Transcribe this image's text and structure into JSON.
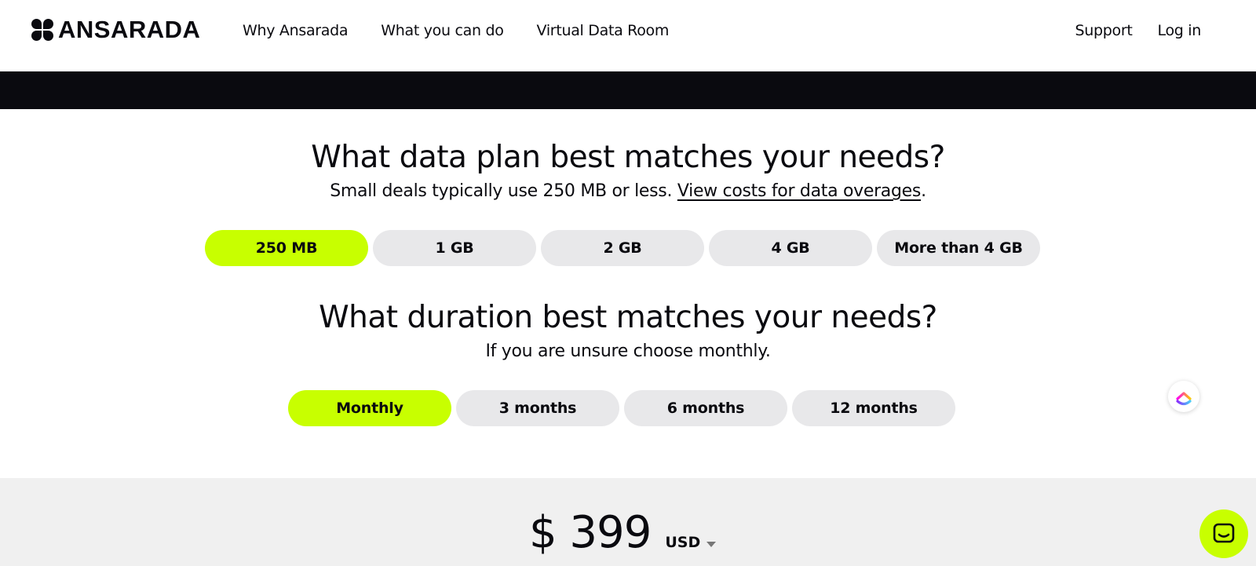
{
  "header": {
    "logo_text": "ANSARADA",
    "nav": [
      {
        "label": "Why Ansarada"
      },
      {
        "label": "What you can do"
      },
      {
        "label": "Virtual Data Room"
      }
    ],
    "support_label": "Support",
    "login_label": "Log in"
  },
  "data_plan": {
    "title": "What data plan best matches your needs?",
    "subtitle": "Small deals typically use 250 MB or less.",
    "link": "View costs for data overages",
    "period": ".",
    "options": [
      "250 MB",
      "1 GB",
      "2 GB",
      "4 GB",
      "More than 4 GB"
    ],
    "selected": "250 MB"
  },
  "duration": {
    "title": "What duration best matches your needs?",
    "subtitle": "If you are unsure choose monthly.",
    "options": [
      "Monthly",
      "3 months",
      "6 months",
      "12 months"
    ],
    "selected": "Monthly"
  },
  "price": {
    "amount": "$ 399",
    "currency": "USD"
  },
  "colors": {
    "accent": "#c8ff00",
    "dark_band": "#0a0a0f",
    "pill_inactive": "#e8e8ea",
    "price_band": "#f0f0f0"
  },
  "icons": {
    "clickup": "clickup-icon",
    "chat": "chat-icon"
  }
}
